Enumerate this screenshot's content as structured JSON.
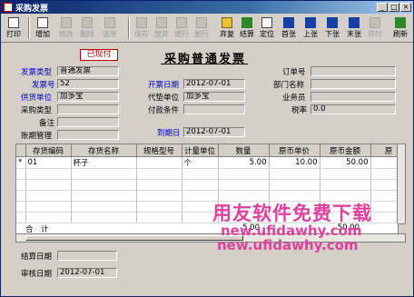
{
  "window": {
    "title": "采购发票"
  },
  "toolbar": {
    "buttons": [
      {
        "label": "打印"
      },
      {
        "label": "增加"
      },
      {
        "label": "修改"
      },
      {
        "label": "删除"
      },
      {
        "label": "选单"
      },
      {
        "label": "保存"
      },
      {
        "label": "放弃"
      },
      {
        "label": "增行"
      },
      {
        "label": "删行"
      },
      {
        "label": "弃复"
      },
      {
        "label": "结算"
      },
      {
        "label": "定位"
      },
      {
        "label": "首张"
      },
      {
        "label": "上张"
      },
      {
        "label": "下张"
      },
      {
        "label": "末张"
      },
      {
        "label": "弃付"
      },
      {
        "label": "刷新"
      }
    ]
  },
  "form": {
    "stamp": "已现付",
    "title": "采购普通发票",
    "fields": {
      "invoice_type": {
        "label": "发票类型",
        "value": "普通发票"
      },
      "invoice_no": {
        "label": "发票号",
        "value": "52"
      },
      "invoice_date": {
        "label": "开票日期",
        "value": "2012-07-01"
      },
      "supplier": {
        "label": "供货单位",
        "value": "加多宝"
      },
      "agent_unit": {
        "label": "代垫单位",
        "value": "加多宝"
      },
      "purchase_type": {
        "label": "采购类型",
        "value": ""
      },
      "payment_terms": {
        "label": "付款条件",
        "value": ""
      },
      "remark": {
        "label": "备注",
        "value": ""
      },
      "account_mgmt": {
        "label": "账期管理",
        "value": ""
      },
      "due_date": {
        "label": "到期日",
        "value": "2012-07-01"
      },
      "order_no": {
        "label": "订单号",
        "value": ""
      },
      "dept": {
        "label": "部门名称",
        "value": ""
      },
      "salesman": {
        "label": "业务员",
        "value": ""
      },
      "tax_rate": {
        "label": "税率",
        "value": "0.0"
      }
    }
  },
  "grid": {
    "columns": [
      "存货编码",
      "存货名称",
      "规格型号",
      "计量单位",
      "数量",
      "原币单价",
      "原币金额",
      "原"
    ],
    "rows": [
      {
        "code": "01",
        "name": "杯子",
        "spec": "",
        "unit": "个",
        "qty": "5.00",
        "price": "10.00",
        "amount": "50.00"
      }
    ],
    "row_marker": "*",
    "total": {
      "label": "合　计",
      "qty": "5.00",
      "amount": "50.00"
    }
  },
  "footer": {
    "settle_date": {
      "label": "结算日期",
      "value": ""
    },
    "audit_date": {
      "label": "审核日期",
      "value": "2012-07-01"
    }
  },
  "watermark": {
    "line1": "用友软件免费下载",
    "line2": "new.ufidawhy.com",
    "line3": "new.ufidawhy.com"
  }
}
